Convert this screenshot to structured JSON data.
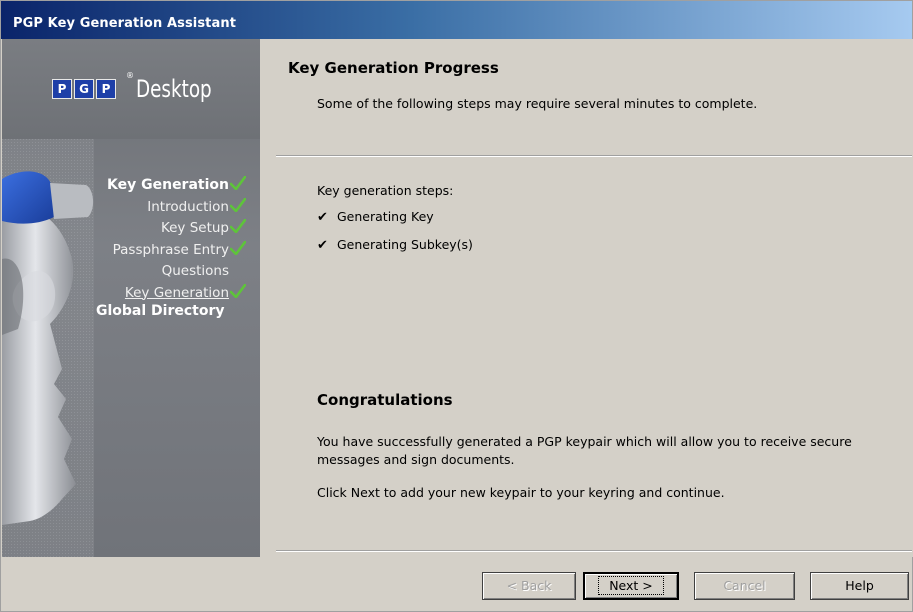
{
  "window": {
    "title": "PGP Key Generation Assistant"
  },
  "sidebar": {
    "logo_letters": [
      "P",
      "G",
      "P"
    ],
    "logo_reg": "®",
    "logo_word": "Desktop",
    "nav": [
      {
        "label": "Key Generation",
        "checked": true
      },
      {
        "label": "Introduction",
        "checked": true
      },
      {
        "label": "Key Setup",
        "checked": true
      },
      {
        "label": "Passphrase Entry",
        "checked": true
      },
      {
        "label": "Questions",
        "checked": false
      },
      {
        "label": "Key Generation",
        "checked": true
      },
      {
        "label": "Global Directory",
        "checked": false
      }
    ]
  },
  "content": {
    "title": "Key Generation Progress",
    "subtitle": "Some of the following steps may require several minutes to complete.",
    "steps_title": "Key generation steps:",
    "steps": [
      "Generating Key",
      "Generating Subkey(s)"
    ],
    "congrats_title": "Congratulations",
    "congrats_text": "You have successfully generated a PGP keypair which will allow you to receive secure messages and sign documents.",
    "continue_text": "Click Next to add your new keypair to your keyring and continue."
  },
  "buttons": {
    "back": "< Back",
    "next": "Next >",
    "cancel": "Cancel",
    "help": "Help"
  },
  "colors": {
    "title_bar": "#0a246a",
    "sidebar": "#7d8086",
    "pgp_blue": "#1e3fa8",
    "check_green": "#5ec43a"
  }
}
